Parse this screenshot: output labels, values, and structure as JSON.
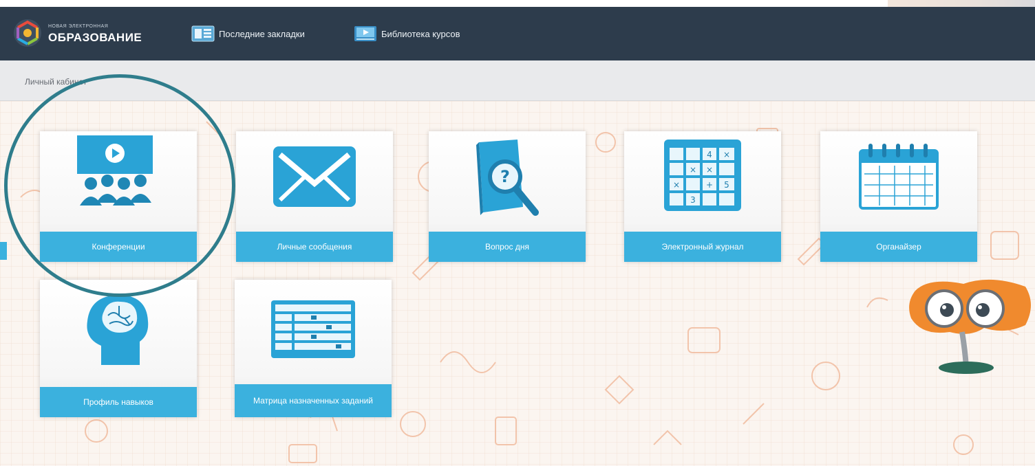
{
  "header": {
    "logo_small": "НОВАЯ ЭЛЕКТРОННАЯ",
    "logo_title": "ОБРАЗОВАНИЕ",
    "nav": [
      {
        "label": "Последние закладки",
        "icon": "bookmarks-icon"
      },
      {
        "label": "Библиотека курсов",
        "icon": "video-library-icon"
      }
    ]
  },
  "breadcrumb": "Личный кабинет",
  "tiles": [
    {
      "label": "Конференции",
      "icon": "conference-icon"
    },
    {
      "label": "Личные сообщения",
      "icon": "envelope-icon"
    },
    {
      "label": "Вопрос дня",
      "icon": "question-book-icon"
    },
    {
      "label": "Электронный журнал",
      "icon": "grade-grid-icon"
    },
    {
      "label": "Органайзер",
      "icon": "calendar-icon"
    },
    {
      "label": "Профиль навыков",
      "icon": "brain-head-icon"
    },
    {
      "label": "Матрица назначенных заданий",
      "icon": "task-matrix-icon"
    }
  ],
  "colors": {
    "header_bg": "#2d3c4c",
    "tile_label_bg": "#3bb1de",
    "highlight_ring": "#2f7d8c",
    "doodle": "#f0b89a"
  }
}
